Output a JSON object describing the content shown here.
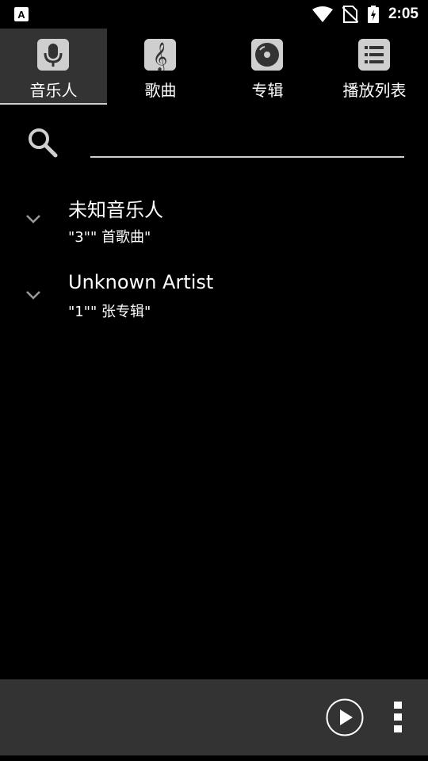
{
  "status_bar": {
    "time": "2:05",
    "icons": [
      "a-notification-icon",
      "wifi-icon",
      "no-sim-icon",
      "battery-charging-icon"
    ]
  },
  "tabs": [
    {
      "label": "音乐人",
      "icon": "microphone-icon",
      "active": true
    },
    {
      "label": "歌曲",
      "icon": "music-note-icon",
      "active": false
    },
    {
      "label": "专辑",
      "icon": "disc-icon",
      "active": false
    },
    {
      "label": "播放列表",
      "icon": "list-icon",
      "active": false
    }
  ],
  "search": {
    "placeholder": "",
    "value": ""
  },
  "list": [
    {
      "title": "未知音乐人",
      "subtitle": "\"3\"\" 首歌曲\""
    },
    {
      "title": "Unknown Artist",
      "subtitle": "\"1\"\" 张专辑\""
    }
  ],
  "bottom_bar": {
    "icons": [
      "play-icon",
      "more-vert-icon"
    ]
  },
  "colors": {
    "background": "#000000",
    "tab_active": "#333333",
    "icon": "#cfcfcf",
    "bottom_bar": "#333333"
  }
}
